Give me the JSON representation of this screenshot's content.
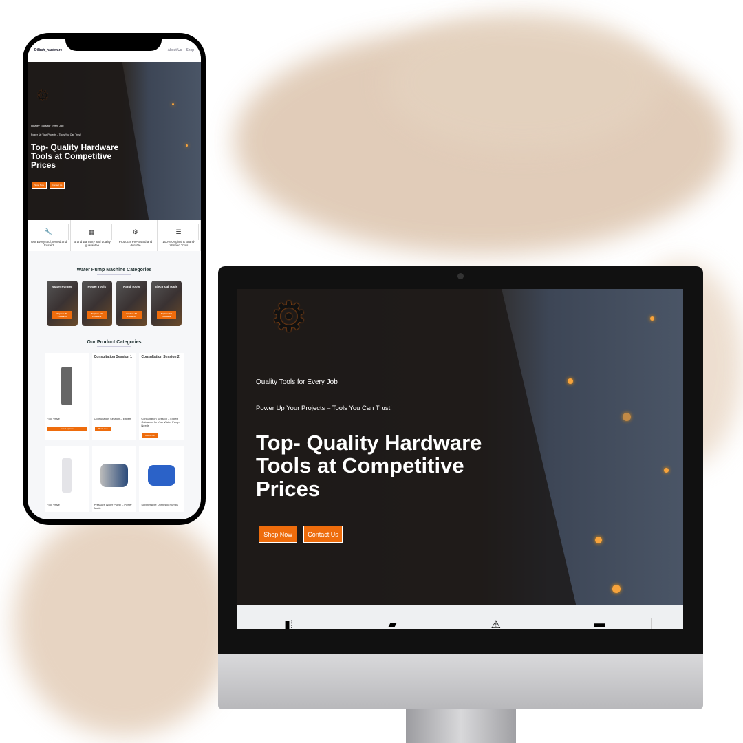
{
  "site": {
    "brand": "Dilbah_hardware",
    "nav": [
      "About Us",
      "Shop"
    ],
    "tagline": "Quality Tools for Every Job",
    "subtagline": "Power Up Your Projects – Tools You Can Trust!",
    "headline": "Top- Quality Hardware Tools at Competitive Prices",
    "buttons": {
      "shop": "Shop Now",
      "contact": "Contact Us"
    },
    "features": [
      "Our Every tool, tested and trusted",
      "Brand warranty and quality guarantee",
      "Products Pre-tested and durable",
      "100% Original & Brand-Verified Tools"
    ],
    "feature_icons": [
      "tool-icon",
      "warranty-icon",
      "gear-icon",
      "stack-icon"
    ],
    "categories_title": "Water Pump Machine Categories",
    "categories": [
      {
        "name": "Water Pumps",
        "cta": "Explore All Products"
      },
      {
        "name": "Power Tools",
        "cta": "Explore All Products"
      },
      {
        "name": "Hand Tools",
        "cta": "Explore All Products"
      },
      {
        "name": "Electrical Tools",
        "cta": "Explore All Products"
      }
    ],
    "products_title": "Our Product Categories",
    "products": [
      {
        "title": "",
        "name": "Foot Valve",
        "cta": "Select options"
      },
      {
        "title": "Consultation Session 1",
        "name": "Consultation Session – Expert",
        "cta": "Book now"
      },
      {
        "title": "Consultation Session 2",
        "name": "Consultation Session – Expert Guidance for Your Water Pump Needs",
        "cta": "Add to cart"
      }
    ],
    "products_row2": [
      "Foot Valve",
      "Pressure Water Pump – Power Mode",
      "Submersible Domestic Pumps"
    ]
  },
  "colors": {
    "accent": "#ee6c0c",
    "hero_dark": "#2a2420"
  }
}
